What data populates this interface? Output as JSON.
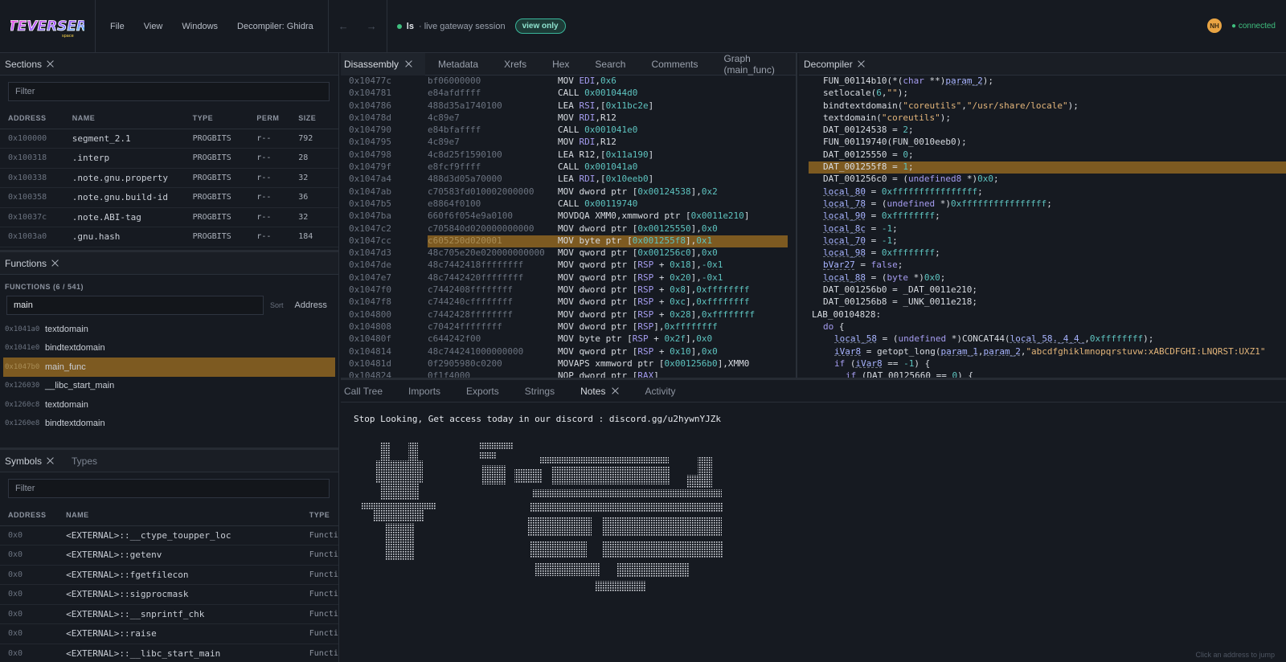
{
  "app": {
    "logo_alt": "TEVERSER",
    "menus": [
      "File",
      "View",
      "Windows",
      "Decompiler: Ghidra"
    ],
    "nav_back": "←",
    "nav_forward": "→",
    "session_user": "ls",
    "session_text": "· live gateway session",
    "view_mode": "view only",
    "avatar": "NH",
    "connection": "● connected"
  },
  "sections": {
    "title": "Sections",
    "filter_placeholder": "Filter",
    "columns": [
      "ADDRESS",
      "NAME",
      "TYPE",
      "PERM",
      "SIZE"
    ],
    "rows": [
      [
        "0x100000",
        "segment_2.1",
        "PROGBITS",
        "r--",
        "792"
      ],
      [
        "0x100318",
        ".interp",
        "PROGBITS",
        "r--",
        "28"
      ],
      [
        "0x100338",
        ".note.gnu.property",
        "PROGBITS",
        "r--",
        "32"
      ],
      [
        "0x100358",
        ".note.gnu.build-id",
        "PROGBITS",
        "r--",
        "36"
      ],
      [
        "0x10037c",
        ".note.ABI-tag",
        "PROGBITS",
        "r--",
        "32"
      ],
      [
        "0x1003a0",
        ".gnu.hash",
        "PROGBITS",
        "r--",
        "184"
      ]
    ]
  },
  "functions": {
    "title": "Functions",
    "count_label": "FUNCTIONS (6 / 541)",
    "search_value": "main",
    "sort_label": "Sort",
    "sort_value": "Address",
    "rows": [
      {
        "addr": "0x1041a0",
        "name": "textdomain"
      },
      {
        "addr": "0x1041e0",
        "name": "bindtextdomain"
      },
      {
        "addr": "0x1047b0",
        "name": "main_func",
        "selected": true
      },
      {
        "addr": "0x126030",
        "name": "__libc_start_main"
      },
      {
        "addr": "0x1260c8",
        "name": "textdomain"
      },
      {
        "addr": "0x1260e8",
        "name": "bindtextdomain"
      }
    ]
  },
  "symbols": {
    "title": "Symbols",
    "types_tab": "Types",
    "filter_placeholder": "Filter",
    "columns": [
      "ADDRESS",
      "NAME",
      "TYPE"
    ],
    "rows": [
      [
        "0x0",
        "<EXTERNAL>::__ctype_toupper_loc",
        "Functi"
      ],
      [
        "0x0",
        "<EXTERNAL>::getenv",
        "Functi"
      ],
      [
        "0x0",
        "<EXTERNAL>::fgetfilecon",
        "Functi"
      ],
      [
        "0x0",
        "<EXTERNAL>::sigprocmask",
        "Functi"
      ],
      [
        "0x0",
        "<EXTERNAL>::__snprintf_chk",
        "Functi"
      ],
      [
        "0x0",
        "<EXTERNAL>::raise",
        "Functi"
      ],
      [
        "0x0",
        "<EXTERNAL>::__libc_start_main",
        "Functi"
      ]
    ]
  },
  "disassembly": {
    "tabs": [
      "Disassembly",
      "Metadata",
      "Xrefs",
      "Hex",
      "Search",
      "Comments",
      "Graph (main_func)"
    ],
    "lines": [
      {
        "addr": "0x10477c",
        "bytes": "bf06000000",
        "ins": "MOV <r>EDI</r>,<n>0x6</n>"
      },
      {
        "addr": "0x104781",
        "bytes": "e84afdffff",
        "ins": "CALL <n>0x001044d0</n>"
      },
      {
        "addr": "0x104786",
        "bytes": "488d35a1740100",
        "ins": "LEA <r>RSI</r>,[<n>0x11bc2e</n>]"
      },
      {
        "addr": "0x10478d",
        "bytes": "4c89e7",
        "ins": "MOV <r>RDI</r>,R12"
      },
      {
        "addr": "0x104790",
        "bytes": "e84bfaffff",
        "ins": "CALL <n>0x001041e0</n>"
      },
      {
        "addr": "0x104795",
        "bytes": "4c89e7",
        "ins": "MOV <r>RDI</r>,R12"
      },
      {
        "addr": "0x104798",
        "bytes": "4c8d25f1590100",
        "ins": "LEA R12,[<n>0x11a190</n>]"
      },
      {
        "addr": "0x10479f",
        "bytes": "e8fcf9ffff",
        "ins": "CALL <n>0x001041a0</n>"
      },
      {
        "addr": "0x1047a4",
        "bytes": "488d3d05a70000",
        "ins": "LEA <r>RDI</r>,[<n>0x10eeb0</n>]"
      },
      {
        "addr": "0x1047ab",
        "bytes": "c70583fd010002000000",
        "ins": "MOV dword ptr [<n>0x00124538</n>],<n>0x2</n>"
      },
      {
        "addr": "0x1047b5",
        "bytes": "e8864f0100",
        "ins": "CALL <n>0x00119740</n>"
      },
      {
        "addr": "0x1047ba",
        "bytes": "660f6f054e9a0100",
        "ins": "MOVDQA XMM0,xmmword ptr [<n>0x0011e210</n>]"
      },
      {
        "addr": "0x1047c2",
        "bytes": "c705840d020000000000",
        "ins": "MOV dword ptr [<n>0x00125550</n>],<n>0x0</n>"
      },
      {
        "addr": "0x1047cc",
        "bytes": "c605250d020001",
        "ins": "MOV byte ptr [<n>0x001255f8</n>],<n>0x1</n>",
        "hl": true
      },
      {
        "addr": "0x1047d3",
        "bytes": "48c705e20e020000000000",
        "ins": "MOV qword ptr [<n>0x001256c0</n>],<n>0x0</n>"
      },
      {
        "addr": "0x1047de",
        "bytes": "48c7442418ffffffff",
        "ins": "MOV qword ptr [<r>RSP</r> + <n>0x18</n>],<n>-0x1</n>"
      },
      {
        "addr": "0x1047e7",
        "bytes": "48c7442420ffffffff",
        "ins": "MOV qword ptr [<r>RSP</r> + <n>0x20</n>],<n>-0x1</n>"
      },
      {
        "addr": "0x1047f0",
        "bytes": "c7442408ffffffff",
        "ins": "MOV dword ptr [<r>RSP</r> + <n>0x8</n>],<n>0xffffffff</n>"
      },
      {
        "addr": "0x1047f8",
        "bytes": "c744240cffffffff",
        "ins": "MOV dword ptr [<r>RSP</r> + <n>0xc</n>],<n>0xffffffff</n>"
      },
      {
        "addr": "0x104800",
        "bytes": "c7442428ffffffff",
        "ins": "MOV dword ptr [<r>RSP</r> + <n>0x28</n>],<n>0xffffffff</n>"
      },
      {
        "addr": "0x104808",
        "bytes": "c70424ffffffff",
        "ins": "MOV dword ptr [<r>RSP</r>],<n>0xffffffff</n>"
      },
      {
        "addr": "0x10480f",
        "bytes": "c644242f00",
        "ins": "MOV byte ptr [<r>RSP</r> + <n>0x2f</n>],<n>0x0</n>"
      },
      {
        "addr": "0x104814",
        "bytes": "48c744241000000000",
        "ins": "MOV qword ptr [<r>RSP</r> + <n>0x10</n>],<n>0x0</n>"
      },
      {
        "addr": "0x10481d",
        "bytes": "0f2905980c0200",
        "ins": "MOVAPS xmmword ptr [<n>0x001256b0</n>],XMM0"
      },
      {
        "addr": "0x104824",
        "bytes": "0f1f4000",
        "ins": "NOP dword ptr [<r>RAX</r>]"
      }
    ]
  },
  "decompiler": {
    "title": "Decompiler",
    "lines": [
      {
        "indent": 1,
        "html": "FUN_00114b10(*(<k>char</k> **)<v>param_2</v>);"
      },
      {
        "indent": 1,
        "html": "setlocale(<n>6</n>,<s>\"\"</s>);"
      },
      {
        "indent": 1,
        "html": "bindtextdomain(<s>\"coreutils\"</s>,<s>\"/usr/share/locale\"</s>);"
      },
      {
        "indent": 1,
        "html": "textdomain(<s>\"coreutils\"</s>);"
      },
      {
        "indent": 1,
        "html": "DAT_00124538 = <n>2</n>;"
      },
      {
        "indent": 1,
        "html": "FUN_00119740(FUN_0010eeb0);"
      },
      {
        "indent": 1,
        "html": "DAT_00125550 = <n>0</n>;"
      },
      {
        "indent": 1,
        "html": "DAT_001255f8 = <n>1</n>;",
        "hl": true
      },
      {
        "indent": 1,
        "html": "DAT_001256c0 = (<k>undefined8</k> *)<n>0x0</n>;"
      },
      {
        "indent": 1,
        "html": "<v>local_80</v> = <n>0xffffffffffffffff</n>;"
      },
      {
        "indent": 1,
        "html": "<v>local_78</v> = (<k>undefined</k> *)<n>0xffffffffffffffff</n>;"
      },
      {
        "indent": 1,
        "html": "<v>local_90</v> = <n>0xffffffff</n>;"
      },
      {
        "indent": 1,
        "html": "<v>local_8c</v> = <n>-1</n>;"
      },
      {
        "indent": 1,
        "html": "<v>local_70</v> = <n>-1</n>;"
      },
      {
        "indent": 1,
        "html": "<v>local_98</v> = <n>0xffffffff</n>;"
      },
      {
        "indent": 1,
        "html": "<v>bVar27</v> = <k>false</k>;"
      },
      {
        "indent": 1,
        "html": "<v>local_88</v> = (<k>byte</k> *)<n>0x0</n>;"
      },
      {
        "indent": 1,
        "html": "DAT_001256b0 = _DAT_0011e210;"
      },
      {
        "indent": 1,
        "html": "DAT_001256b8 = _UNK_0011e218;"
      },
      {
        "indent": 0,
        "html": "LAB_00104828:"
      },
      {
        "indent": 1,
        "html": "<k>do</k> {"
      },
      {
        "indent": 2,
        "html": "<v>local_58</v> = (<k>undefined</k> *)CONCAT44(<v>local_58._4_4_</v>,<n>0xffffffff</n>);"
      },
      {
        "indent": 2,
        "html": "<v>iVar8</v> = getopt_long(<v>param_1</v>,<v>param_2</v>,<s>\"abcdfghiklmnopqrstuvw:xABCDFGHI:LNQRST:UXZ1\"</s>"
      },
      {
        "indent": 2,
        "html": "<k>if</k> (<v>iVar8</v> == <n>-1</n>) {"
      },
      {
        "indent": 3,
        "html": "<k>if</k> (DAT_00125660 == <n>0</n>) {"
      }
    ]
  },
  "bottom": {
    "tabs": [
      "Call Tree",
      "Imports",
      "Exports",
      "Strings",
      "Notes",
      "Activity"
    ],
    "active_tab": "Notes",
    "notes_text": "Stop Looking, Get access today in our discord : discord.gg/u2hywnYJZk",
    "jump_hint": "Click an address to jump"
  }
}
